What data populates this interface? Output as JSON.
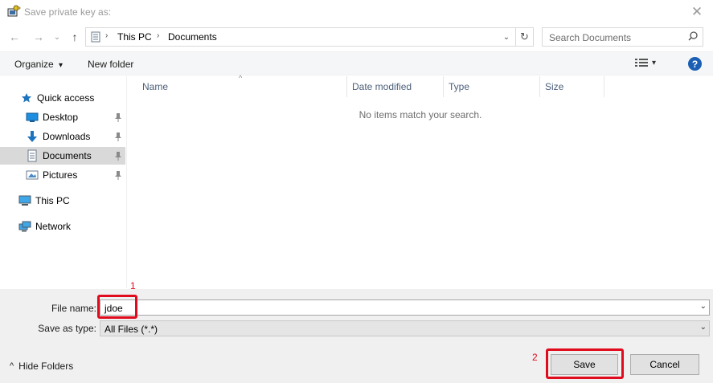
{
  "window": {
    "title": "Save private key as:",
    "close_glyph": "✕"
  },
  "navigation": {
    "back_glyph": "←",
    "forward_glyph": "→",
    "recent_glyph": "⌄",
    "up_glyph": "↑",
    "breadcrumb": [
      "This PC",
      "Documents"
    ],
    "breadcrumb_sep": "›",
    "dropdown_glyph": "⌄",
    "refresh_glyph": "↻",
    "search_placeholder": "Search Documents"
  },
  "toolbar": {
    "organize_label": "Organize",
    "organize_arrow": "▾",
    "new_folder_label": "New folder",
    "view_arrow": "▾",
    "help_label": "?"
  },
  "sidebar": {
    "quick_access": "Quick access",
    "items": [
      {
        "label": "Desktop",
        "icon": "desktop-icon",
        "pinned": true
      },
      {
        "label": "Downloads",
        "icon": "downloads-icon",
        "pinned": true
      },
      {
        "label": "Documents",
        "icon": "documents-icon",
        "pinned": true,
        "selected": true
      },
      {
        "label": "Pictures",
        "icon": "pictures-icon",
        "pinned": true
      }
    ],
    "this_pc": "This PC",
    "network": "Network"
  },
  "file_list": {
    "sort_glyph": "^",
    "columns": [
      "Name",
      "Date modified",
      "Type",
      "Size"
    ],
    "empty_message": "No items match your search."
  },
  "form": {
    "file_name_label": "File name:",
    "file_name_value": "jdoe",
    "save_as_type_label": "Save as type:",
    "save_as_type_value": "All Files (*.*)",
    "dropdown_glyph": "⌄"
  },
  "annotations": {
    "step1": "1",
    "step2": "2",
    "highlight_color": "#e00b1c"
  },
  "footer": {
    "hide_folders_glyph": "^",
    "hide_folders_label": "Hide Folders",
    "save_label": "Save",
    "cancel_label": "Cancel"
  }
}
